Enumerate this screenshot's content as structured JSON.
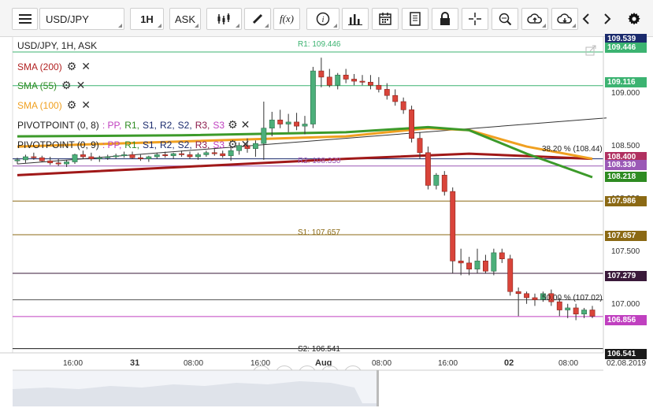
{
  "toolbar": {
    "symbol": "USD/JPY",
    "interval": "1H",
    "price_side": "ASK",
    "fx_label": "f(x)"
  },
  "chart_header": "USD/JPY, 1H, ASK",
  "legends": [
    {
      "label": "SMA (200)",
      "color": "#b22222"
    },
    {
      "label": "SMA (55)",
      "color": "#2e8b22"
    },
    {
      "label": "SMA (100)",
      "color": "#f0a020"
    },
    {
      "label": "PIVOTPOINT (0, 8)",
      "color": "#222222",
      "parts": [
        ": PP,",
        "R1,",
        "S1,",
        "R2,",
        "S2,",
        "R3,",
        "S3"
      ]
    },
    {
      "label": "PIVOTPOINT (0, 9)",
      "color": "#222222",
      "parts": [
        ": PP,",
        "R1,",
        "S1,",
        "R2,",
        "S2,",
        "R3,",
        "S3"
      ]
    }
  ],
  "price_axis": {
    "ticks": [
      "109.000",
      "108.500",
      "108.000",
      "107.500",
      "107.000"
    ],
    "tags": [
      {
        "text": "109.539",
        "color": "#1a2a6c"
      },
      {
        "text": "109.446",
        "color": "#3cb371"
      },
      {
        "text": "109.116",
        "color": "#3cb371"
      },
      {
        "text": "108.400",
        "color": "#b03060"
      },
      {
        "text": "108.330",
        "color": "#9b59b6"
      },
      {
        "text": "108.218",
        "color": "#2e8b22"
      },
      {
        "text": "107.986",
        "color": "#8b6914"
      },
      {
        "text": "107.657",
        "color": "#8b6914"
      },
      {
        "text": "107.279",
        "color": "#3a1a3a"
      },
      {
        "text": "106.856",
        "color": "#c040c0"
      },
      {
        "text": "106.541",
        "color": "#1a1a1a"
      }
    ]
  },
  "chart_labels": {
    "r1": "R1: 109.446",
    "s1": "S1: 107.657",
    "s2": "S2: 106.541",
    "r2": "R2: 108.330",
    "fib382": "38.20 % (108.44)",
    "fib50": "50.00 % (107.02)"
  },
  "time_axis": [
    "16:00",
    "31",
    "08:00",
    "16:00",
    "Aug",
    "08:00",
    "16:00",
    "02",
    "08:00",
    "02.08.2019"
  ],
  "chart_data": {
    "type": "candlestick",
    "ylim": [
      106.5,
      109.6
    ],
    "candles": [
      {
        "o": 108.38,
        "h": 108.41,
        "l": 108.35,
        "c": 108.39
      },
      {
        "o": 108.39,
        "h": 108.44,
        "l": 108.36,
        "c": 108.42
      },
      {
        "o": 108.42,
        "h": 108.46,
        "l": 108.39,
        "c": 108.41
      },
      {
        "o": 108.41,
        "h": 108.43,
        "l": 108.37,
        "c": 108.38
      },
      {
        "o": 108.38,
        "h": 108.42,
        "l": 108.34,
        "c": 108.36
      },
      {
        "o": 108.36,
        "h": 108.4,
        "l": 108.33,
        "c": 108.35
      },
      {
        "o": 108.35,
        "h": 108.39,
        "l": 108.32,
        "c": 108.37
      },
      {
        "o": 108.37,
        "h": 108.45,
        "l": 108.35,
        "c": 108.44
      },
      {
        "o": 108.44,
        "h": 108.48,
        "l": 108.4,
        "c": 108.42
      },
      {
        "o": 108.42,
        "h": 108.46,
        "l": 108.38,
        "c": 108.4
      },
      {
        "o": 108.4,
        "h": 108.43,
        "l": 108.37,
        "c": 108.41
      },
      {
        "o": 108.41,
        "h": 108.44,
        "l": 108.39,
        "c": 108.42
      },
      {
        "o": 108.42,
        "h": 108.45,
        "l": 108.4,
        "c": 108.43
      },
      {
        "o": 108.43,
        "h": 108.47,
        "l": 108.41,
        "c": 108.44
      },
      {
        "o": 108.44,
        "h": 108.47,
        "l": 108.4,
        "c": 108.41
      },
      {
        "o": 108.41,
        "h": 108.44,
        "l": 108.38,
        "c": 108.4
      },
      {
        "o": 108.4,
        "h": 108.43,
        "l": 108.37,
        "c": 108.42
      },
      {
        "o": 108.42,
        "h": 108.46,
        "l": 108.4,
        "c": 108.44
      },
      {
        "o": 108.44,
        "h": 108.47,
        "l": 108.41,
        "c": 108.43
      },
      {
        "o": 108.43,
        "h": 108.46,
        "l": 108.4,
        "c": 108.45
      },
      {
        "o": 108.45,
        "h": 108.48,
        "l": 108.42,
        "c": 108.44
      },
      {
        "o": 108.44,
        "h": 108.47,
        "l": 108.4,
        "c": 108.42
      },
      {
        "o": 108.42,
        "h": 108.46,
        "l": 108.39,
        "c": 108.44
      },
      {
        "o": 108.44,
        "h": 108.48,
        "l": 108.42,
        "c": 108.46
      },
      {
        "o": 108.46,
        "h": 108.5,
        "l": 108.43,
        "c": 108.45
      },
      {
        "o": 108.45,
        "h": 108.48,
        "l": 108.41,
        "c": 108.43
      },
      {
        "o": 108.43,
        "h": 108.52,
        "l": 108.38,
        "c": 108.48
      },
      {
        "o": 108.48,
        "h": 108.56,
        "l": 108.44,
        "c": 108.53
      },
      {
        "o": 108.53,
        "h": 108.6,
        "l": 108.46,
        "c": 108.5
      },
      {
        "o": 108.5,
        "h": 108.58,
        "l": 108.42,
        "c": 108.55
      },
      {
        "o": 108.55,
        "h": 108.96,
        "l": 108.39,
        "c": 108.7
      },
      {
        "o": 108.7,
        "h": 108.86,
        "l": 108.62,
        "c": 108.78
      },
      {
        "o": 108.78,
        "h": 108.88,
        "l": 108.7,
        "c": 108.74
      },
      {
        "o": 108.74,
        "h": 108.84,
        "l": 108.66,
        "c": 108.76
      },
      {
        "o": 108.76,
        "h": 108.85,
        "l": 108.68,
        "c": 108.72
      },
      {
        "o": 108.72,
        "h": 108.82,
        "l": 108.64,
        "c": 108.74
      },
      {
        "o": 108.74,
        "h": 109.3,
        "l": 108.7,
        "c": 109.26
      },
      {
        "o": 109.26,
        "h": 109.39,
        "l": 109.1,
        "c": 109.2
      },
      {
        "o": 109.2,
        "h": 109.28,
        "l": 109.1,
        "c": 109.12
      },
      {
        "o": 109.12,
        "h": 109.24,
        "l": 109.08,
        "c": 109.22
      },
      {
        "o": 109.22,
        "h": 109.28,
        "l": 109.14,
        "c": 109.18
      },
      {
        "o": 109.18,
        "h": 109.23,
        "l": 109.12,
        "c": 109.16
      },
      {
        "o": 109.16,
        "h": 109.22,
        "l": 109.12,
        "c": 109.15
      },
      {
        "o": 109.15,
        "h": 109.22,
        "l": 109.08,
        "c": 109.12
      },
      {
        "o": 109.12,
        "h": 109.2,
        "l": 109.05,
        "c": 109.08
      },
      {
        "o": 109.08,
        "h": 109.14,
        "l": 108.98,
        "c": 109.02
      },
      {
        "o": 109.02,
        "h": 109.08,
        "l": 108.92,
        "c": 108.96
      },
      {
        "o": 108.96,
        "h": 109.0,
        "l": 108.84,
        "c": 108.88
      },
      {
        "o": 108.88,
        "h": 108.92,
        "l": 108.56,
        "c": 108.6
      },
      {
        "o": 108.6,
        "h": 108.66,
        "l": 108.4,
        "c": 108.46
      },
      {
        "o": 108.46,
        "h": 108.52,
        "l": 108.1,
        "c": 108.14
      },
      {
        "o": 108.14,
        "h": 108.26,
        "l": 108.1,
        "c": 108.24
      },
      {
        "o": 108.24,
        "h": 108.28,
        "l": 108.04,
        "c": 108.08
      },
      {
        "o": 108.08,
        "h": 108.12,
        "l": 107.28,
        "c": 107.4
      },
      {
        "o": 107.4,
        "h": 107.52,
        "l": 107.26,
        "c": 107.38
      },
      {
        "o": 107.38,
        "h": 107.44,
        "l": 107.26,
        "c": 107.32
      },
      {
        "o": 107.32,
        "h": 107.52,
        "l": 107.28,
        "c": 107.4
      },
      {
        "o": 107.4,
        "h": 107.46,
        "l": 107.28,
        "c": 107.3
      },
      {
        "o": 107.3,
        "h": 107.52,
        "l": 107.26,
        "c": 107.48
      },
      {
        "o": 107.48,
        "h": 107.52,
        "l": 107.38,
        "c": 107.42
      },
      {
        "o": 107.42,
        "h": 107.46,
        "l": 107.06,
        "c": 107.1
      },
      {
        "o": 107.1,
        "h": 107.14,
        "l": 106.86,
        "c": 107.08
      },
      {
        "o": 107.08,
        "h": 107.1,
        "l": 106.98,
        "c": 107.04
      },
      {
        "o": 107.04,
        "h": 107.08,
        "l": 106.96,
        "c": 107.02
      },
      {
        "o": 107.02,
        "h": 107.1,
        "l": 107.0,
        "c": 107.08
      },
      {
        "o": 107.08,
        "h": 107.12,
        "l": 106.96,
        "c": 107.0
      },
      {
        "o": 107.0,
        "h": 107.04,
        "l": 106.86,
        "c": 106.92
      },
      {
        "o": 106.92,
        "h": 106.98,
        "l": 106.84,
        "c": 106.94
      },
      {
        "o": 106.94,
        "h": 106.98,
        "l": 106.82,
        "c": 106.88
      },
      {
        "o": 106.88,
        "h": 106.94,
        "l": 106.84,
        "c": 106.92
      },
      {
        "o": 106.92,
        "h": 106.96,
        "l": 106.84,
        "c": 106.86
      }
    ],
    "sma200": [
      [
        0,
        108.24
      ],
      [
        20,
        108.32
      ],
      [
        40,
        108.4
      ],
      [
        55,
        108.45
      ],
      [
        70,
        108.4
      ]
    ],
    "sma55": [
      [
        0,
        108.62
      ],
      [
        20,
        108.63
      ],
      [
        40,
        108.66
      ],
      [
        50,
        108.71
      ],
      [
        55,
        108.68
      ],
      [
        62,
        108.45
      ],
      [
        70,
        108.22
      ]
    ],
    "sma100": [
      [
        0,
        108.52
      ],
      [
        20,
        108.57
      ],
      [
        40,
        108.62
      ],
      [
        50,
        108.7
      ],
      [
        55,
        108.68
      ],
      [
        62,
        108.52
      ],
      [
        70,
        108.4
      ]
    ],
    "trendline": [
      [
        0,
        108.35
      ],
      [
        70,
        108.8
      ]
    ],
    "levels": [
      {
        "name": "R1",
        "price": 109.446,
        "color": "#3cb371"
      },
      {
        "name": "PP",
        "price": 109.116,
        "color": "#3cb371"
      },
      {
        "name": "R2",
        "price": 108.33,
        "color": "#9b59b6"
      },
      {
        "name": "Fib382",
        "price": 108.4,
        "color": "#1a2a6c"
      },
      {
        "name": "S1a",
        "price": 107.986,
        "color": "#8b6914"
      },
      {
        "name": "S1",
        "price": 107.657,
        "color": "#8b6914"
      },
      {
        "name": "S1b",
        "price": 107.279,
        "color": "#3a1a3a"
      },
      {
        "name": "Fib50",
        "price": 107.02,
        "color": "#555555"
      },
      {
        "name": "Last",
        "price": 106.856,
        "color": "#c040c0"
      },
      {
        "name": "S2",
        "price": 106.541,
        "color": "#1a1a1a"
      }
    ]
  }
}
